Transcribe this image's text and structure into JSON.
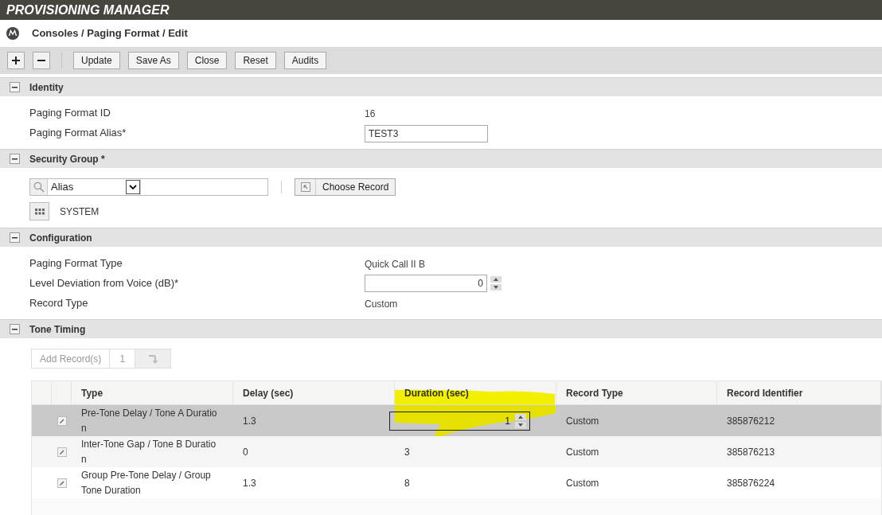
{
  "app_title": "PROVISIONING MANAGER",
  "breadcrumb": "Consoles / Paging Format / Edit",
  "toolbar": {
    "buttons": [
      "Update",
      "Save As",
      "Close",
      "Reset",
      "Audits"
    ]
  },
  "identity": {
    "title": "Identity",
    "expanded": true,
    "fields": [
      {
        "kind": "text",
        "label": "Paging Format ID",
        "value": "16"
      },
      {
        "kind": "input",
        "label": "Paging Format Alias*",
        "value": "TEST3"
      }
    ]
  },
  "security_group": {
    "title": "Security Group *",
    "expanded": true,
    "search_field": "Alias",
    "choose_button": "Choose Record",
    "value": "SYSTEM"
  },
  "configuration": {
    "title": "Configuration",
    "expanded": true,
    "fields": [
      {
        "kind": "text",
        "label": "Paging Format Type",
        "value": "Quick Call II B"
      },
      {
        "kind": "spinner",
        "label": "Level Deviation from Voice (dB)*",
        "value": "0"
      },
      {
        "kind": "text",
        "label": "Record Type",
        "value": "Custom"
      }
    ]
  },
  "tone_timing": {
    "title": "Tone Timing",
    "expanded": true,
    "add_records": {
      "label": "Add Record(s)",
      "count": "1"
    },
    "table": {
      "columns": [
        "Type",
        "Delay (sec)",
        "Duration (sec)",
        "Record Type",
        "Record Identifier"
      ],
      "rows": [
        {
          "selected": true,
          "editing": true,
          "type": "Pre-Tone Delay / Tone A Duration",
          "delay": "1.3",
          "duration": "1",
          "record_type": "Custom",
          "record_identifier": "385876212"
        },
        {
          "selected": false,
          "editing": false,
          "type": "Inter-Tone Gap / Tone B Duration",
          "delay": "0",
          "duration": "3",
          "record_type": "Custom",
          "record_identifier": "385876213"
        },
        {
          "selected": false,
          "editing": false,
          "type": "Group Pre-Tone Delay / Group Tone Duration",
          "delay": "1.3",
          "duration": "8",
          "record_type": "Custom",
          "record_identifier": "385876224"
        }
      ]
    }
  }
}
